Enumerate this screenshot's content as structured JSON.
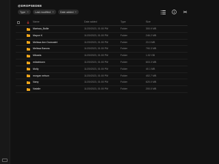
{
  "app": {
    "title": "@DROPSEDEE"
  },
  "filters": [
    {
      "label": "Type"
    },
    {
      "label": "Last modified"
    },
    {
      "label": "Date added"
    }
  ],
  "toolbar": {
    "icons": [
      "list-view-icon",
      "info-icon",
      "collapse-icon"
    ]
  },
  "table": {
    "headers": {
      "name": "Name",
      "date": "Date added",
      "type": "Type",
      "size": "Size"
    },
    "rows": [
      {
        "name": "Marissa_Bullie",
        "date": "11/20/2023, 01:00 PM",
        "type": "Folder",
        "size": "300.9 MB"
      },
      {
        "name": "Mayce K",
        "date": "11/20/2023, 01:00 PM",
        "type": "Folder",
        "size": "246.2 MB"
      },
      {
        "name": "Melissa Ann Dunsralet",
        "date": "11/20/2023, 01:00 PM",
        "type": "Folder",
        "size": "23.3 MB"
      },
      {
        "name": "Melissa Barons",
        "date": "11/20/2023, 01:00 PM",
        "type": "Folder",
        "size": "790.3 MB"
      },
      {
        "name": "Mikaela",
        "date": "11/20/2023, 01:00 PM",
        "type": "Folder",
        "size": "1.02 GB"
      },
      {
        "name": "milaxblown",
        "date": "11/20/2023, 01:00 PM",
        "type": "Folder",
        "size": "603.3 MB"
      },
      {
        "name": "Molly",
        "date": "11/20/2023, 01:00 PM",
        "type": "Folder",
        "size": "40.1 MB"
      },
      {
        "name": "morgan nelson",
        "date": "11/20/2023, 01:00 PM",
        "type": "Folder",
        "size": "402.7 MB"
      },
      {
        "name": "Nany",
        "date": "11/20/2023, 01:00 PM",
        "type": "Folder",
        "size": "620.0 MB"
      },
      {
        "name": "Natalie",
        "date": "11/20/2023, 01:00 PM",
        "type": "Folder",
        "size": "200.0 MB"
      }
    ]
  },
  "colors": {
    "folder": "#f2a71b",
    "background": "#121212",
    "chip": "#2c2c2c",
    "text_muted": "#8a8a8a"
  }
}
